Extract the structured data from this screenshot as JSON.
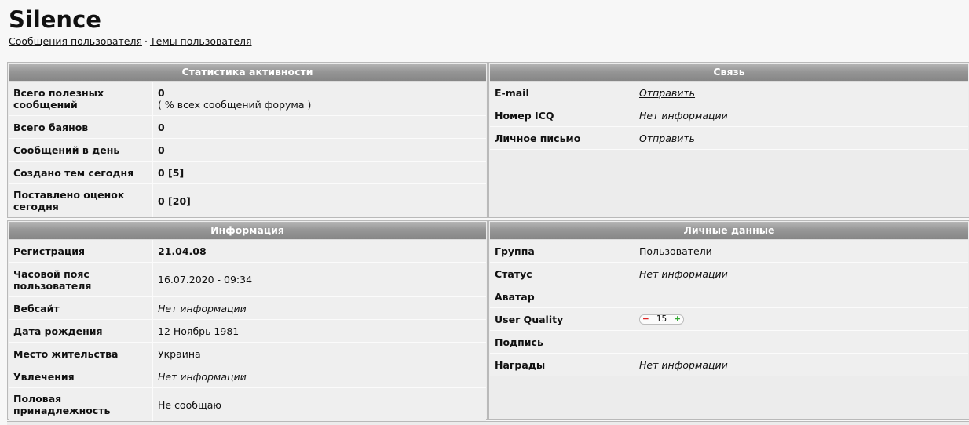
{
  "page": {
    "username": "Silence",
    "links": [
      "Сообщения пользователя",
      "Темы пользователя"
    ],
    "separator": "·"
  },
  "activity": {
    "header": "Статистика активности",
    "rows": [
      {
        "label": "Всего полезных сообщений",
        "value": "0",
        "note": "( % всех сообщений форума )"
      },
      {
        "label": "Всего баянов",
        "value": "0"
      },
      {
        "label": "Сообщений в день",
        "value": "0"
      },
      {
        "label": "Создано тем сегодня",
        "value": "0 [5]"
      },
      {
        "label": "Поставлено оценок сегодня",
        "value": "0 [20]"
      }
    ]
  },
  "contact": {
    "header": "Связь",
    "rows": [
      {
        "label": "E-mail",
        "value": "Отправить"
      },
      {
        "label": "Номер ICQ",
        "value": "Нет информации"
      },
      {
        "label": "Личное письмо",
        "value": "Отправить"
      }
    ]
  },
  "info": {
    "header": "Информация",
    "rows": [
      {
        "label": "Регистрация",
        "value": "21.04.08"
      },
      {
        "label": "Часовой пояс пользователя",
        "value": "16.07.2020 - 09:34"
      },
      {
        "label": "Вебсайт",
        "value": "Нет информации"
      },
      {
        "label": "Дата рождения",
        "value": "12 Ноябрь 1981"
      },
      {
        "label": "Место жительства",
        "value": "Украина"
      },
      {
        "label": "Увлечения",
        "value": "Нет информации"
      },
      {
        "label": "Половая принадлежность",
        "value": "Не сообщаю"
      }
    ]
  },
  "personal": {
    "header": "Личные данные",
    "rows": [
      {
        "label": "Группа",
        "value": "Пользователи"
      },
      {
        "label": "Статус",
        "value": "Нет информации"
      },
      {
        "label": "Аватар",
        "value": ""
      },
      {
        "label": "User Quality",
        "minus": "−",
        "value": "15",
        "plus": "+"
      },
      {
        "label": "Подпись",
        "value": ""
      },
      {
        "label": "Награды",
        "value": "Нет информации"
      }
    ]
  }
}
